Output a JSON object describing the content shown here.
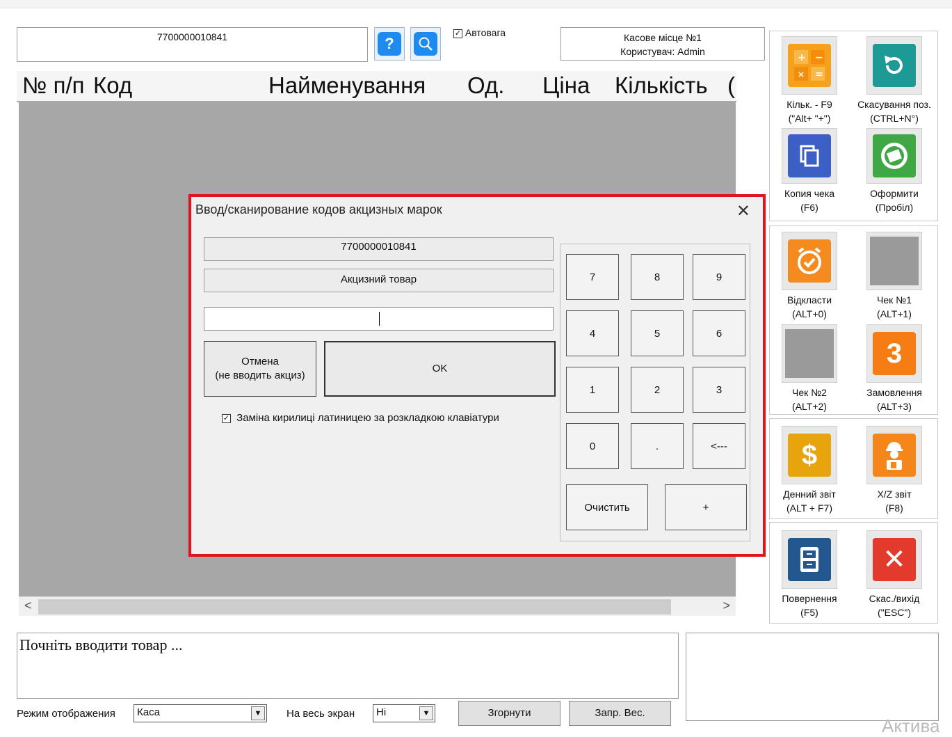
{
  "header": {
    "barcode_value": "7700000010841",
    "help_icon_glyph": "?",
    "search_icon": "search-icon",
    "autoweight_label": "Автовага",
    "autoweight_checked": true,
    "cashier_line1": "Касове місце №1",
    "cashier_line2": "Користувач: Admin"
  },
  "grid": {
    "columns": [
      "№ п/п",
      "Код",
      "Найменування",
      "Од.",
      "Ціна",
      "Кількість",
      "("
    ]
  },
  "scroll": {
    "left_arrow": "<",
    "right_arrow": ">"
  },
  "message": {
    "text": "Почніть вводити товар ..."
  },
  "footer": {
    "display_mode_label": "Режим отображения",
    "display_mode_value": "Каса",
    "fullscreen_label": "На весь экран",
    "fullscreen_value": "Ні",
    "collapse_label": "Згорнути",
    "weight_request_label": "Запр. Вес."
  },
  "side_panel": {
    "tiles": [
      {
        "line1": "Кільк. - F9",
        "line2": "(\"Alt+ \"+\")",
        "icon": "calculator-icon",
        "color": "#f7a01c"
      },
      {
        "line1": "Скасування поз.",
        "line2": "(CTRL+N°)",
        "icon": "undo-icon",
        "color": "#1e9a96"
      },
      {
        "line1": "Копия чека",
        "line2": "(F6)",
        "icon": "copy-icon",
        "color": "#3b5fc5"
      },
      {
        "line1": "Оформити",
        "line2": "(Пробіл)",
        "icon": "money-stack-icon",
        "color": "#3fa844"
      },
      {
        "line1": "Відкласти",
        "line2": "(ALT+0)",
        "icon": "alarm-clock-icon",
        "color": "#f58a1f"
      },
      {
        "line1": "Чек №1",
        "line2": "(ALT+1)",
        "icon": "empty-slot-icon",
        "color": "#9a9a9a"
      },
      {
        "line1": "Чек №2",
        "line2": "(ALT+2)",
        "icon": "empty-slot-icon",
        "color": "#9a9a9a"
      },
      {
        "line1": "Замовлення",
        "line2": "(ALT+3)",
        "icon": "number-three-icon",
        "glyph": "3",
        "color": "#f57d14"
      },
      {
        "line1": "Денний звіт",
        "line2": "(ALT + F7)",
        "icon": "dollar-icon",
        "glyph": "$",
        "color": "#e8a40c"
      },
      {
        "line1": "X/Z звіт",
        "line2": "(F8)",
        "icon": "worker-icon",
        "color": "#f5871a"
      },
      {
        "line1": "Повернення",
        "line2": "(F5)",
        "icon": "cabinet-icon",
        "color": "#22578f"
      },
      {
        "line1": "Скас./вихід",
        "line2": "(\"ESC\")",
        "icon": "close-x-icon",
        "glyph": "✕",
        "color": "#e23b2e"
      }
    ]
  },
  "watermark": "Актива",
  "dialog": {
    "title": "Ввод/сканирование кодов акцизных марок",
    "close_glyph": "✕",
    "barcode": "7700000010841",
    "product_name": "Акцизний товар",
    "excise_input_value": "",
    "cancel_line1": "Отмена",
    "cancel_line2": "(не вводить акциз)",
    "ok_label": "OK",
    "replace_cyrillic_label": "Заміна кирилиці латиницею за розкладкою клавіатури",
    "replace_cyrillic_checked": true,
    "keys": [
      "7",
      "8",
      "9",
      "4",
      "5",
      "6",
      "1",
      "2",
      "3",
      "0",
      ".",
      "<---"
    ],
    "clear_label": "Очистить",
    "plus_label": "+"
  }
}
